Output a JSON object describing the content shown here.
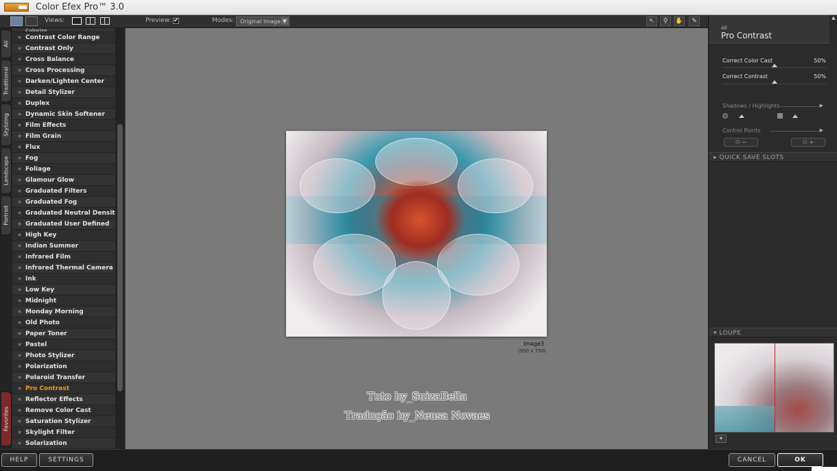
{
  "window": {
    "title": "Color Efex Pro™ 3.0"
  },
  "toolbar": {
    "views_label": "Views:",
    "preview_label": "Preview:",
    "preview_checked": "✔",
    "modes_label": "Modes:",
    "modes_value": "Original Image"
  },
  "tabs": [
    "All",
    "Traditional",
    "Stylizing",
    "Landscape",
    "Portrait",
    "Favorites"
  ],
  "filters": [
    "Colorize",
    "Contrast Color Range",
    "Contrast Only",
    "Cross Balance",
    "Cross Processing",
    "Darken/Lighten Center",
    "Detail Stylizer",
    "Duplex",
    "Dynamic Skin Softener",
    "Film Effects",
    "Film Grain",
    "Flux",
    "Fog",
    "Foliage",
    "Glamour Glow",
    "Graduated Filters",
    "Graduated Fog",
    "Graduated Neutral Density",
    "Graduated User Defined",
    "High Key",
    "Indian Summer",
    "Infrared Film",
    "Infrared Thermal Camera",
    "Ink",
    "Low Key",
    "Midnight",
    "Monday Morning",
    "Old Photo",
    "Paper Toner",
    "Pastel",
    "Photo Stylizer",
    "Polarization",
    "Polaroid Transfer",
    "Pro Contrast",
    "Reflector Effects",
    "Remove Color Cast",
    "Saturation Stylizer",
    "Skylight Filter",
    "Solarization"
  ],
  "selected_filter": "Pro Contrast",
  "canvas": {
    "image_name": "Image3",
    "image_size": "(950 x 750)",
    "watermark_line1": "Tuto by_SuizaBella",
    "watermark_line2": "Tradução by_Neusa Novaes"
  },
  "panel": {
    "category": "All",
    "filter_name": "Pro Contrast",
    "params": [
      {
        "label": "Correct Color Cast",
        "value": "50%",
        "level": 0.5
      },
      {
        "label": "Correct Contrast",
        "value": "50%",
        "level": 0.5
      }
    ],
    "shadows_highlights": "Shadows / Highlights",
    "control_points": "Control Points",
    "quick_save": "QUICK SAVE SLOTS",
    "loupe": "LOUPE"
  },
  "buttons": {
    "help": "HELP",
    "settings": "SETTINGS",
    "cancel": "CANCEL",
    "ok": "OK"
  },
  "colors": {
    "selected_filter": "#f59a1e",
    "canvas_bg": "#7a7a7a",
    "loupe_divider": "#d42020"
  }
}
